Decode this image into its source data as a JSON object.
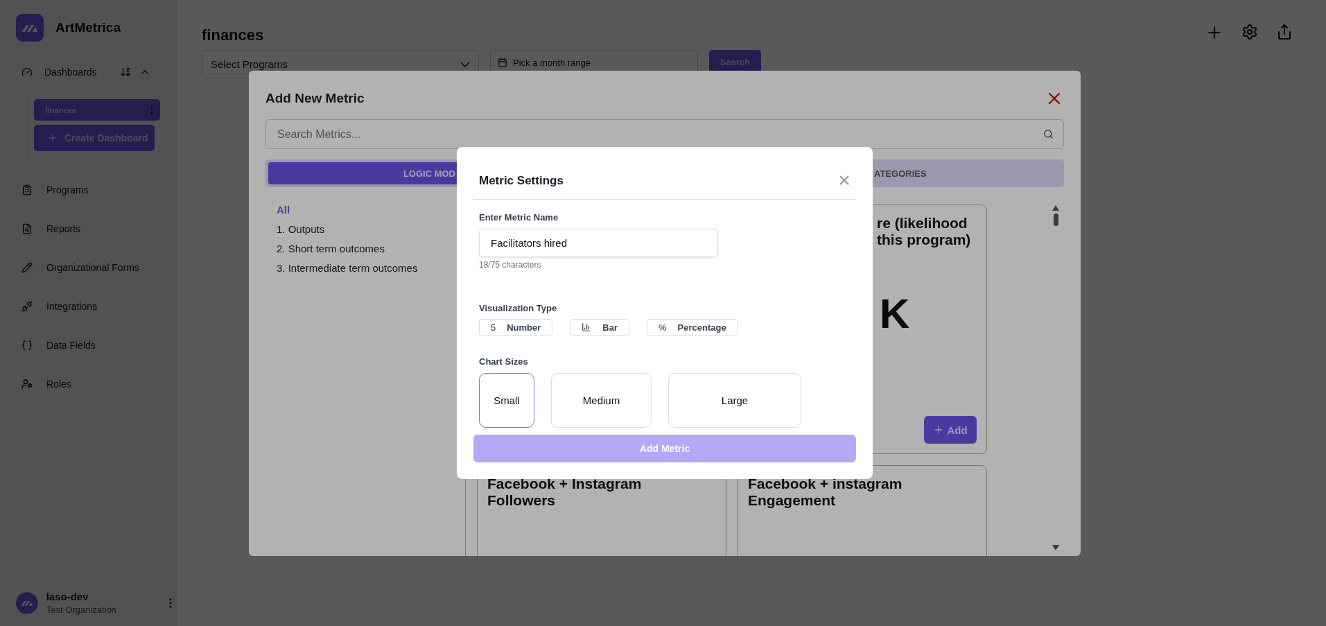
{
  "sidebar": {
    "brand": "ArtMetrica",
    "dashboards": {
      "label": "Dashboards",
      "expanded": true,
      "items": [
        {
          "label": "finances",
          "selected": true
        }
      ],
      "create_button": "Create Dashboard"
    },
    "nav": [
      {
        "label": "Programs",
        "kind": "clipboard"
      },
      {
        "label": "Reports",
        "kind": "report"
      },
      {
        "label": "Organizational Forms",
        "kind": "pencil"
      },
      {
        "label": "Integrations",
        "kind": "plug"
      },
      {
        "label": "Data Fields",
        "kind": "brackets"
      },
      {
        "label": "Roles",
        "kind": "user"
      }
    ],
    "user": {
      "name": "laso-dev",
      "organization": "Test Organization"
    }
  },
  "header": {
    "title": "finances",
    "program_select": {
      "placeholder": "Select Programs"
    },
    "month_range": {
      "placeholder": "Pick a month range"
    },
    "search_button": "Search"
  },
  "add_metric_modal": {
    "title": "Add New Metric",
    "search": {
      "placeholder": "Search Metrics..."
    },
    "tabs": [
      {
        "label": "LOGIC MOD",
        "selected": true
      },
      {
        "label": "ATEGORIES",
        "selected": false
      }
    ],
    "categories": [
      {
        "label": "All",
        "selected": true
      },
      {
        "label": "1. Outputs",
        "selected": false
      },
      {
        "label": "2. Short term outcomes",
        "selected": false
      },
      {
        "label": "3. Intermediate term outcomes",
        "selected": false
      }
    ],
    "cards": [
      {
        "kind": "partial",
        "title_lines": [
          "re (likelihood",
          "this program)"
        ],
        "value": "K",
        "add_button": "Add"
      },
      {
        "kind": "full",
        "title_lines": [
          "Facebook + Instagram",
          "Followers"
        ]
      },
      {
        "kind": "full",
        "title_lines": [
          "Facebook + instagram",
          "Engagement"
        ]
      }
    ]
  },
  "metric_settings": {
    "title": "Metric Settings",
    "name_label": "Enter Metric Name",
    "name_value": "Facilitators hired",
    "char_count": "18/75 characters",
    "viz_label": "Visualization Type",
    "viz_types": [
      {
        "kind": "number",
        "glyph": "5",
        "label": "Number",
        "selected": false
      },
      {
        "kind": "bar",
        "label": "Bar",
        "selected": false
      },
      {
        "kind": "percentage",
        "glyph": "%",
        "label": "Percentage",
        "selected": false
      }
    ],
    "sizes_label": "Chart Sizes",
    "sizes": [
      {
        "label": "Small",
        "selected": true
      },
      {
        "label": "Medium",
        "selected": false
      },
      {
        "label": "Large",
        "selected": false
      }
    ],
    "submit": {
      "label": "Add Metric",
      "disabled": true
    }
  }
}
